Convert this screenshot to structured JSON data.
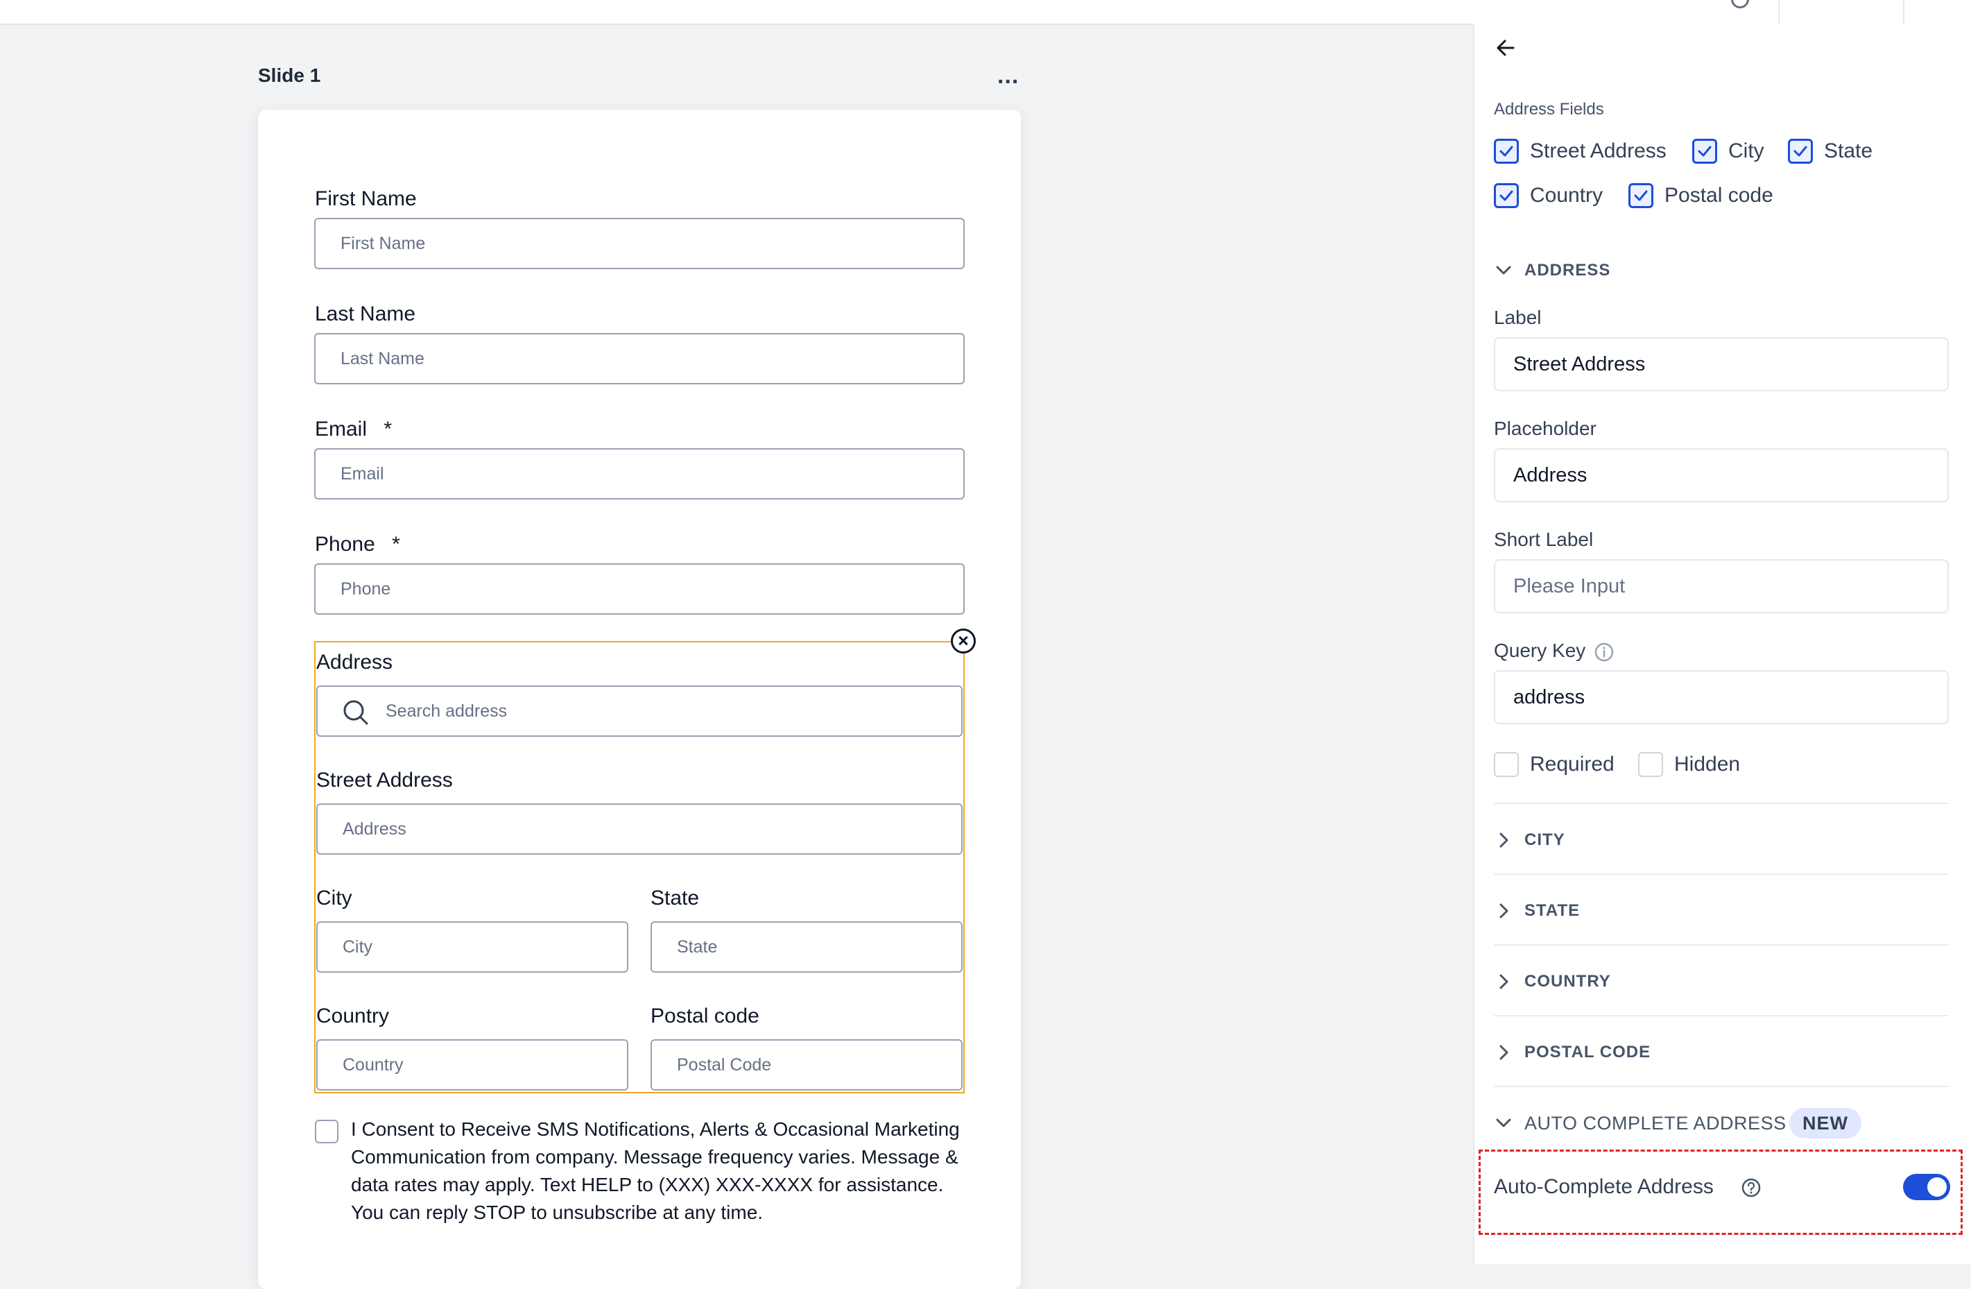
{
  "slide": {
    "title": "Slide 1",
    "menu": "...",
    "fields": {
      "first_name": {
        "label": "First Name",
        "placeholder": "First Name"
      },
      "last_name": {
        "label": "Last Name",
        "placeholder": "Last Name"
      },
      "email": {
        "label": "Email",
        "required_mark": "*",
        "placeholder": "Email"
      },
      "phone": {
        "label": "Phone",
        "required_mark": "*",
        "placeholder": "Phone"
      }
    },
    "address": {
      "label": "Address",
      "search_placeholder": "Search address",
      "street_label": "Street Address",
      "street_placeholder": "Address",
      "city_label": "City",
      "city_placeholder": "City",
      "state_label": "State",
      "state_placeholder": "State",
      "country_label": "Country",
      "country_placeholder": "Country",
      "postal_label": "Postal code",
      "postal_placeholder": "Postal Code"
    },
    "consent_text": "I Consent to Receive SMS Notifications, Alerts & Occasional Marketing Communication from company. Message frequency varies. Message & data rates may apply. Text HELP to (XXX) XXX-XXXX for assistance. You can reply STOP to unsubscribe at any time."
  },
  "panel": {
    "address_fields_title": "Address Fields",
    "checkboxes": {
      "street": "Street Address",
      "city": "City",
      "state": "State",
      "country": "Country",
      "postal": "Postal code"
    },
    "address_section": "ADDRESS",
    "label_title": "Label",
    "label_value": "Street Address",
    "placeholder_title": "Placeholder",
    "placeholder_value": "Address",
    "short_label_title": "Short Label",
    "short_label_placeholder": "Please Input",
    "query_key_title": "Query Key",
    "query_key_value": "address",
    "required": "Required",
    "hidden": "Hidden",
    "sections": {
      "city": "CITY",
      "state": "STATE",
      "country": "COUNTRY",
      "postal": "POSTAL CODE"
    },
    "auto_complete_section": "AUTO COMPLETE ADDRESS",
    "new_badge": "NEW",
    "auto_complete_label": "Auto-Complete Address",
    "accent_color": "#1d4ed8",
    "highlight_color": "#f5a524"
  }
}
